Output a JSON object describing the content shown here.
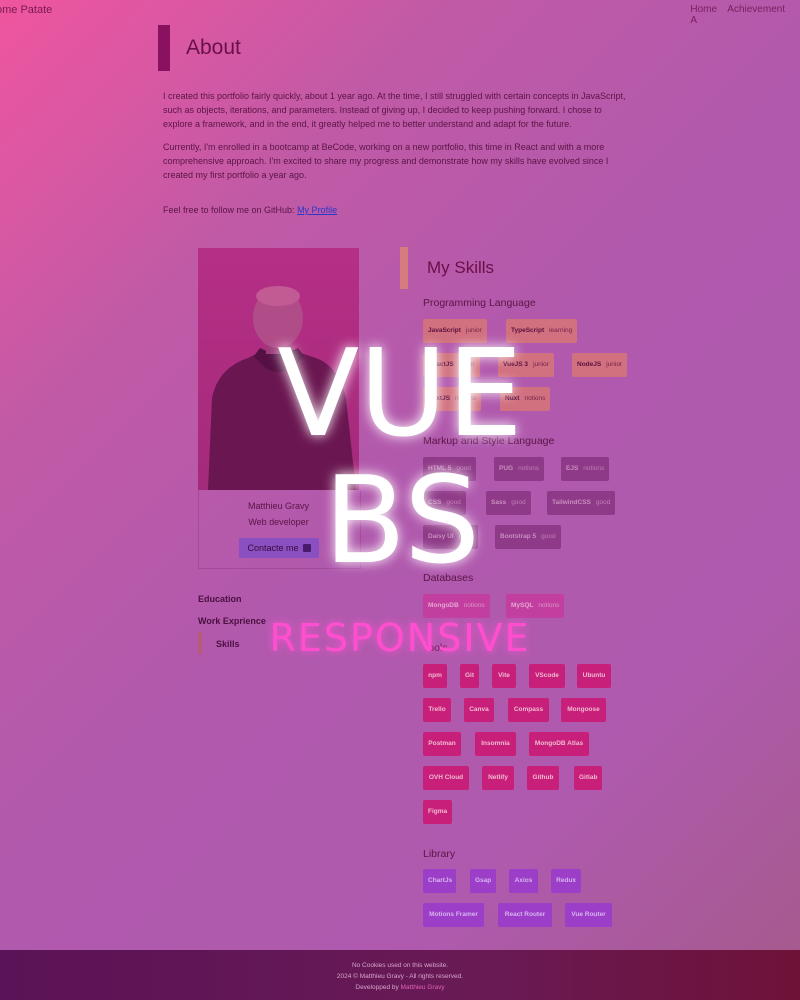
{
  "nav": {
    "brand": "ome Patate",
    "links": [
      "Home",
      "Achievement",
      "A"
    ]
  },
  "about": {
    "title": "About",
    "p1": "I created this portfolio fairly quickly, about 1 year ago. At the time, I still struggled with certain concepts in JavaScript, such as objects, iterations, and parameters. Instead of giving up, I decided to keep pushing forward. I chose to explore a framework, and in the end, it greatly helped me to better understand and adapt for the future.",
    "p2": "Currently, I'm enrolled in a bootcamp at BeCode, working on a new portfolio, this time in React and with a more comprehensive approach. I'm excited to share my progress and demonstrate how my skills have evolved since I created my first portfolio a year ago.",
    "follow_text": "Feel free to follow me on GitHub: ",
    "follow_link": "My Profile"
  },
  "profile": {
    "name": "Matthieu Gravy",
    "role": "Web developer",
    "contact_label": "Contacte me",
    "contact_icon": "linkedin-icon",
    "photo_icon": "portrait-photo"
  },
  "sidebar": {
    "education": "Education",
    "work": "Work Exprience",
    "skills": "Skills"
  },
  "skills": {
    "title": "My Skills",
    "programming": {
      "label": "Programming Language",
      "items": [
        {
          "name": "JavaScript",
          "level": "junior"
        },
        {
          "name": "TypeScript",
          "level": "learning"
        },
        {
          "name": "ReactJS",
          "level": "junior"
        },
        {
          "name": "VueJS 3",
          "level": "junior"
        },
        {
          "name": "NodeJS",
          "level": "junior"
        },
        {
          "name": "NextJS",
          "level": "notions"
        },
        {
          "name": "Nuxt",
          "level": "notions"
        }
      ]
    },
    "markup": {
      "label": "Markup and Style Language",
      "items": [
        {
          "name": "HTML 5",
          "level": "good"
        },
        {
          "name": "PUG",
          "level": "notions"
        },
        {
          "name": "EJS",
          "level": "notions"
        },
        {
          "name": "CSS",
          "level": "good"
        },
        {
          "name": "Sass",
          "level": "good"
        },
        {
          "name": "TailwindCSS",
          "level": "good"
        },
        {
          "name": "Daisy UI",
          "level": "good"
        },
        {
          "name": "Bootstrap 5",
          "level": "good"
        }
      ]
    },
    "databases": {
      "label": "Databases",
      "items": [
        {
          "name": "MongoDB",
          "level": "notions"
        },
        {
          "name": "MySQL",
          "level": "notions"
        }
      ]
    },
    "tools": {
      "label": "Tools",
      "items": [
        "npm",
        "Git",
        "Vite",
        "VScode",
        "Ubuntu",
        "Trello",
        "Canva",
        "Compass",
        "Mongoose",
        "Postman",
        "Insomnia",
        "MongoDB Atlas",
        "OVH Cloud",
        "Netlify",
        "Github",
        "Gitlab",
        "Figma"
      ]
    },
    "library": {
      "label": "Library",
      "items": [
        "ChartJs",
        "Gsap",
        "Axios",
        "Redux",
        "Motions Framer",
        "React Router",
        "Vue Router"
      ]
    }
  },
  "overlay": {
    "line1": "VUE",
    "line2": "BS",
    "line3": "RESPONSIVE"
  },
  "footer": {
    "cookies": "No Cookies used on this website.",
    "copyright": "2024 © Matthieu Gravy - All rights reserved.",
    "dev_prefix": "Developped by ",
    "dev_name": "Matthieu Gravy"
  },
  "colors": {
    "overlay_text": "#ffffff",
    "overlay_pink": "#ff4fd0",
    "tool_badge": "#c81f7a",
    "library_badge": "#9c3ec8"
  }
}
